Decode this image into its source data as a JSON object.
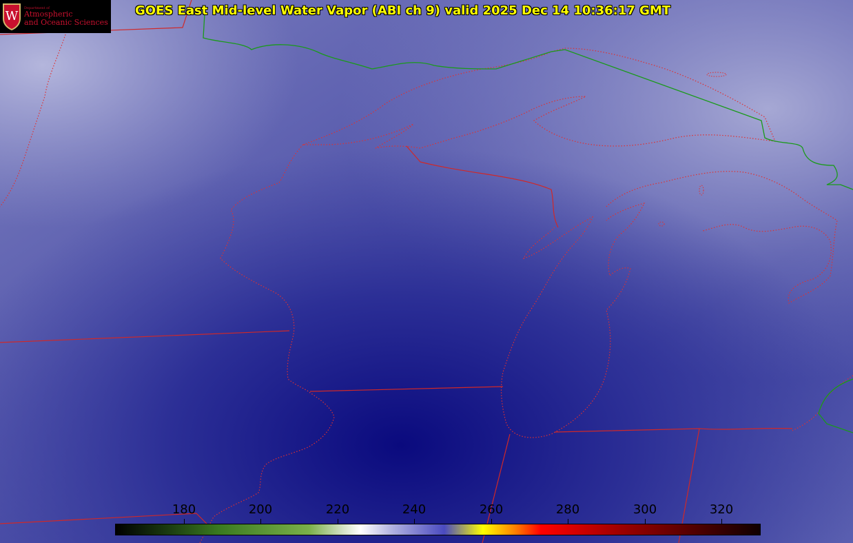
{
  "header": {
    "title": "GOES East Mid-level Water Vapor (ABI ch 9)  valid 2025 Dec 14 10:36:17 GMT"
  },
  "logo": {
    "small_text": "Department of",
    "line1": "Atmospheric",
    "line2": "and Oceanic Sciences",
    "crest_letter": "W"
  },
  "colorbar": {
    "ticks": [
      "180",
      "200",
      "220",
      "240",
      "260",
      "280",
      "300",
      "320"
    ],
    "colors": [
      "#000000",
      "#1a3a10",
      "#3a7a20",
      "#7ab04a",
      "#d0e0c0",
      "#ffffff",
      "#b0b0e0",
      "#4a4ac0",
      "#ffff00",
      "#ff8000",
      "#ff0000",
      "#a00000",
      "#500000",
      "#100000"
    ]
  },
  "map": {
    "background_colors": {
      "dark": "#0a0a7a",
      "mid": "#4a4eaa",
      "light": "#9a9cd0"
    },
    "border_colors": {
      "state": "#e03030",
      "country": "#1a9a1a",
      "coast": "#e03030"
    }
  }
}
